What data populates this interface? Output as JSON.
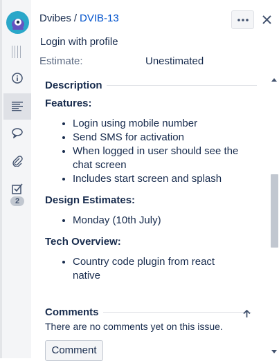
{
  "header": {
    "project": "Dvibes",
    "separator": "/",
    "issue_key": "DVIB-13"
  },
  "issue": {
    "summary": "Login with profile",
    "estimate_label": "Estimate:",
    "estimate_value": "Unestimated"
  },
  "description": {
    "title": "Description",
    "features_heading": "Features:",
    "features": [
      "Login using mobile number",
      "Send SMS for activation",
      "When logged in user should see the chat screen",
      "Includes start screen and splash"
    ],
    "design_heading": "Design Estimates:",
    "design_items": [
      "Monday (10th July)"
    ],
    "tech_heading": "Tech Overview:",
    "tech_items": [
      "Country code plugin from react native"
    ]
  },
  "comments": {
    "title": "Comments",
    "empty_text": "There are no comments yet on this issue.",
    "button_label": "Comment"
  },
  "sidebar": {
    "subtasks_count": "2"
  },
  "icons": {
    "avatar": "project-avatar-icon",
    "more": "more-dots-icon",
    "close": "close-icon",
    "info": "info-icon",
    "description": "description-icon",
    "comment": "comment-icon",
    "attachment": "paperclip-icon",
    "subtasks": "checkbox-icon",
    "scroll_top": "arrow-up-icon"
  },
  "colors": {
    "link": "#0052cc",
    "text": "#172b4d",
    "muted": "#5e6c84",
    "avatar_bg": "#2aa7c9"
  }
}
